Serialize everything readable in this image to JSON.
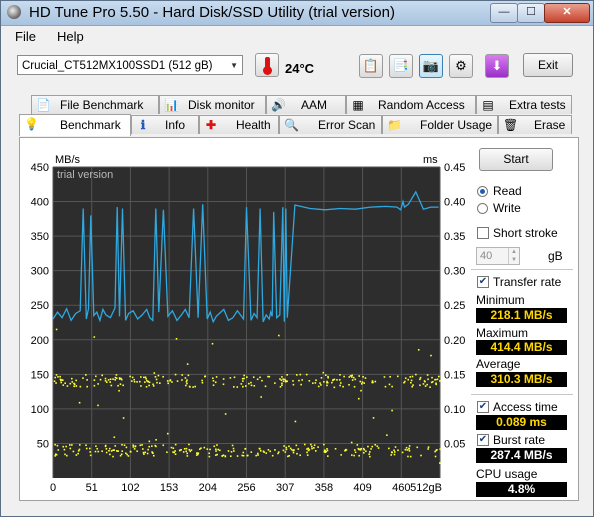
{
  "window": {
    "title": "HD Tune Pro 5.50 - Hard Disk/SSD Utility (trial version)",
    "minimize": "—",
    "maximize": "☐",
    "close": "✕"
  },
  "menu": {
    "file": "File",
    "help": "Help"
  },
  "toolbar": {
    "drive": "Crucial_CT512MX100SSD1 (512 gB)",
    "temperature": "24°C",
    "exit": "Exit",
    "icons": [
      "copy-icon",
      "copy-health-icon",
      "screenshot-icon",
      "options-icon",
      "save-icon"
    ]
  },
  "tabs_row1": [
    "File Benchmark",
    "Disk monitor",
    "AAM",
    "Random Access",
    "Extra tests"
  ],
  "tabs_row2": [
    "Benchmark",
    "Info",
    "Health",
    "Error Scan",
    "Folder Usage",
    "Erase"
  ],
  "selected_tab": "Benchmark",
  "controls": {
    "start": "Start",
    "read": "Read",
    "write": "Write",
    "mode": "read",
    "short_stroke": "Short stroke",
    "short_stroke_value": "40",
    "short_stroke_unit": "gB",
    "transfer_rate": "Transfer rate",
    "minimum_label": "Minimum",
    "minimum": "218.1 MB/s",
    "maximum_label": "Maximum",
    "maximum": "414.4 MB/s",
    "average_label": "Average",
    "average": "310.3 MB/s",
    "access_time": "Access time",
    "access_time_value": "0.089 ms",
    "burst_rate": "Burst rate",
    "burst_rate_value": "287.4 MB/s",
    "cpu_usage_label": "CPU usage",
    "cpu_usage": "4.8%"
  },
  "chart_data": {
    "type": "line",
    "watermark": "trial version",
    "ylabel_left": "MB/s",
    "ylabel_right": "ms",
    "xlabel": "gB",
    "x_ticks": [
      "0",
      "51",
      "102",
      "153",
      "204",
      "256",
      "307",
      "358",
      "409",
      "460",
      "512gB"
    ],
    "y_ticks_left": [
      "450",
      "400",
      "350",
      "300",
      "250",
      "200",
      "150",
      "100",
      "50"
    ],
    "y_ticks_right": [
      "0.45",
      "0.40",
      "0.35",
      "0.30",
      "0.25",
      "0.20",
      "0.15",
      "0.10",
      "0.05"
    ],
    "xlim": [
      0,
      512
    ],
    "ylim_left": [
      0,
      450
    ],
    "ylim_right": [
      0,
      0.45
    ],
    "grid": true,
    "transfer_rate_series": {
      "name": "Transfer rate",
      "color": "#2fa8e0",
      "x": [
        0,
        6,
        12,
        18,
        24,
        30,
        36,
        40,
        44,
        47,
        50,
        54,
        58,
        62,
        66,
        70,
        76,
        82,
        85,
        88,
        92,
        96,
        100,
        106,
        112,
        118,
        124,
        128,
        132,
        136,
        140,
        146,
        152,
        158,
        164,
        170,
        175,
        180,
        186,
        192,
        198,
        204,
        208,
        212,
        216,
        220,
        226,
        232,
        238,
        244,
        248,
        252,
        256,
        262,
        266,
        270,
        274,
        278,
        282,
        286,
        288,
        290,
        292,
        296,
        300,
        304,
        306,
        308,
        310,
        320,
        340,
        360,
        380,
        400,
        420,
        440,
        455,
        460,
        463,
        465,
        470,
        480,
        490,
        500,
        510
      ],
      "values": [
        230,
        240,
        232,
        245,
        228,
        238,
        242,
        390,
        230,
        245,
        380,
        235,
        240,
        228,
        244,
        236,
        232,
        246,
        392,
        234,
        390,
        228,
        238,
        242,
        230,
        236,
        244,
        232,
        228,
        390,
        240,
        388,
        234,
        242,
        228,
        236,
        244,
        232,
        390,
        232,
        396,
        230,
        240,
        226,
        234,
        238,
        244,
        228,
        232,
        242,
        236,
        230,
        392,
        228,
        238,
        232,
        390,
        226,
        236,
        230,
        240,
        234,
        385,
        232,
        236,
        392,
        226,
        390,
        232,
        395,
        390,
        388,
        390,
        389,
        392,
        393,
        392,
        388,
        400,
        392,
        396,
        414,
        389,
        392,
        392
      ]
    },
    "access_time_series": {
      "name": "Access time",
      "color": "#ffff33",
      "y_bands_ms": [
        0.044,
        0.138,
        0.038,
        0.145
      ]
    }
  }
}
